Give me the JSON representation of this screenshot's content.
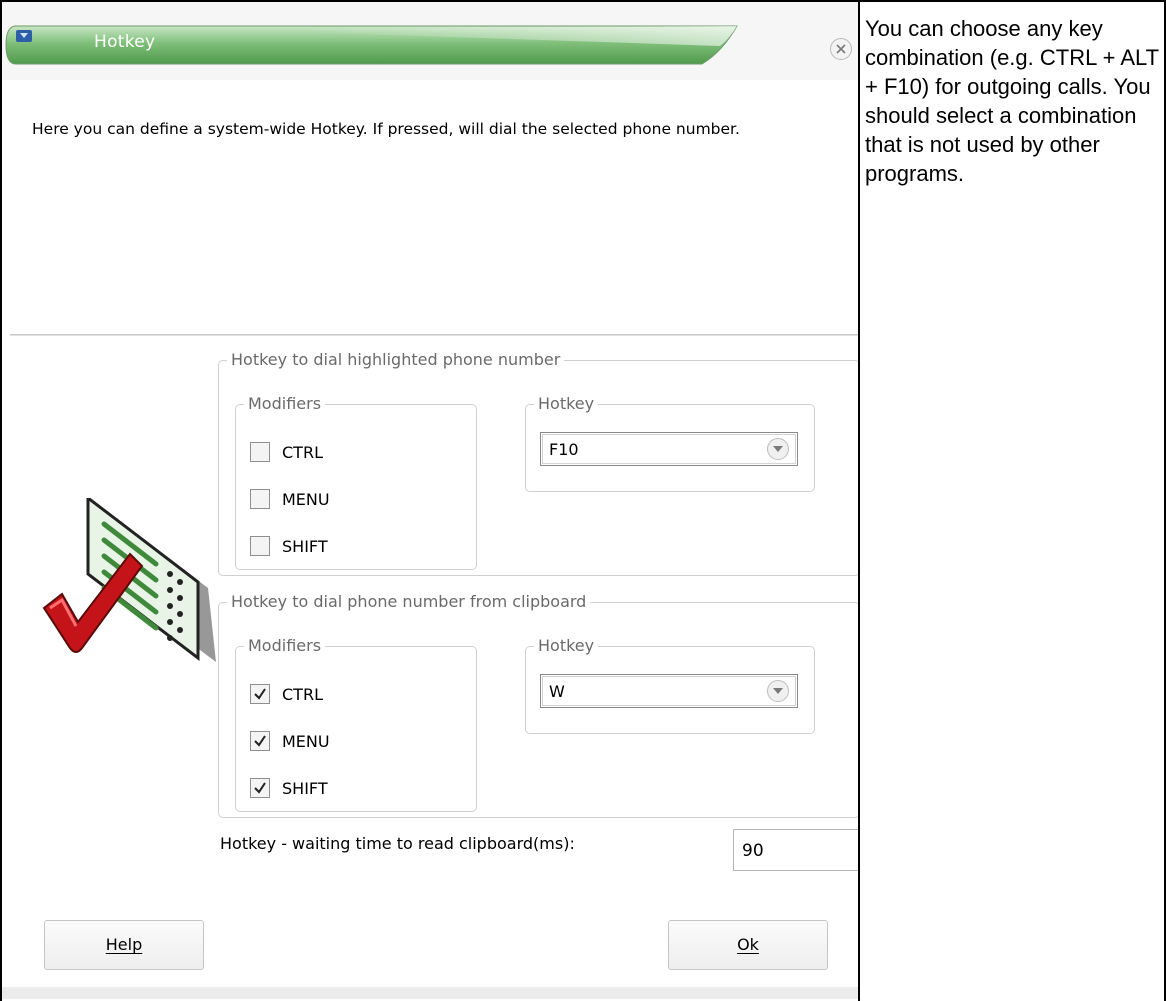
{
  "dialog": {
    "title": "Hotkey",
    "description": "Here you can define a system-wide Hotkey. If pressed,  will dial the selected phone number.",
    "group_highlighted": {
      "legend": "Hotkey to dial highlighted phone number",
      "modifiers_legend": "Modifiers",
      "modifiers": [
        {
          "label": "CTRL",
          "checked": false
        },
        {
          "label": "MENU",
          "checked": false
        },
        {
          "label": "SHIFT",
          "checked": false
        }
      ],
      "hotkey_legend": "Hotkey",
      "hotkey_value": "F10"
    },
    "group_clipboard": {
      "legend": "Hotkey to dial phone number from clipboard",
      "modifiers_legend": "Modifiers",
      "modifiers": [
        {
          "label": "CTRL",
          "checked": true
        },
        {
          "label": "MENU",
          "checked": true
        },
        {
          "label": "SHIFT",
          "checked": true
        }
      ],
      "hotkey_legend": "Hotkey",
      "hotkey_value": "W"
    },
    "wait_label": "Hotkey - waiting time to read clipboard(ms):",
    "wait_value": "90",
    "help_button": "Help",
    "ok_button": "Ok"
  },
  "help_text": "You can choose any key combination (e.g. CTRL + ALT + F10) for outgoing calls. You should select a combination that is not used by other programs.",
  "colors": {
    "title_bar_green": "#6bb26b",
    "frame_border": "#000000"
  }
}
